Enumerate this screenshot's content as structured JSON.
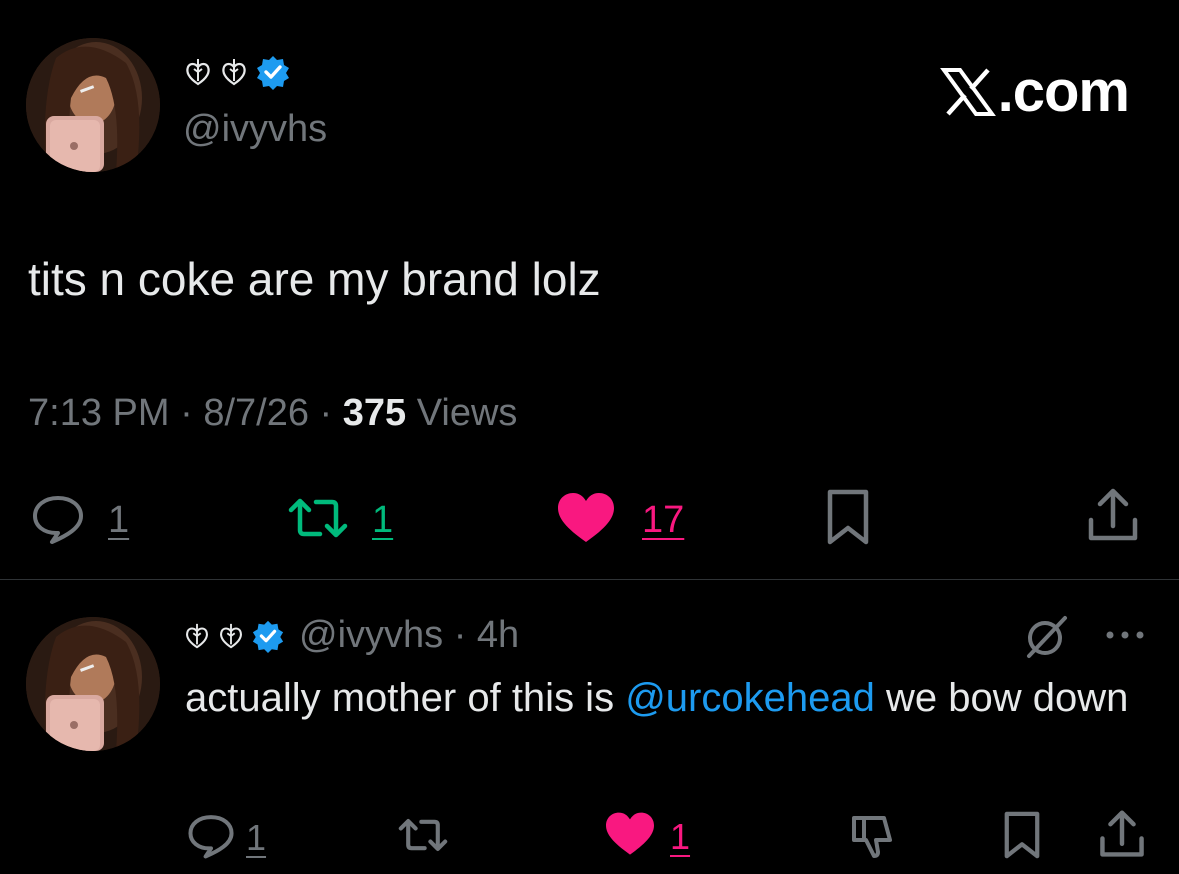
{
  "main_tweet": {
    "handle": "@ivyvhs",
    "site_logo_text": ".com",
    "text": "tits n coke are my brand lolz",
    "time": "7:13 PM",
    "sep1": " · ",
    "date": "8/7/26",
    "sep2": " · ",
    "views_count": "375",
    "views_label": " Views",
    "stats": {
      "replies": "1",
      "retweets": "1",
      "likes": "17"
    }
  },
  "reply": {
    "handle_time": "@ivyvhs · 4h",
    "text_before": "actually mother of this is ",
    "mention": "@urcokehead",
    "text_after": " we bow down",
    "stats": {
      "replies": "1",
      "likes": "1"
    }
  },
  "icons": {
    "name_emoji": "seedling-hearts-icon",
    "verified": "verified-badge-icon",
    "site_logo": "x-logo-icon",
    "reply": "speech-bubble-icon",
    "retweet": "retweet-icon",
    "like": "heart-icon",
    "bookmark": "bookmark-icon",
    "share": "share-icon",
    "grok": "grok-icon",
    "more": "more-icon",
    "dislike": "thumbs-down-icon"
  },
  "colors": {
    "background": "#000000",
    "text": "#e7e9ea",
    "muted": "#71767b",
    "retweet": "#00ba7c",
    "like": "#f91880",
    "mention": "#1d9bf0",
    "verified": "#1d9bf0",
    "divider": "#2f3336"
  }
}
